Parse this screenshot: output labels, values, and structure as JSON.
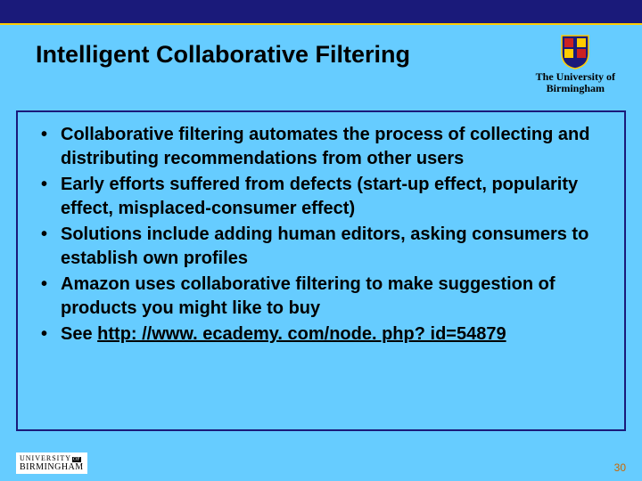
{
  "header": {
    "title": "Intelligent Collaborative Filtering",
    "university_line1": "The University of",
    "university_line2": "Birmingham"
  },
  "bullets": [
    "Collaborative filtering automates the process of collecting and distributing recommendations from other users",
    "Early efforts suffered from defects (start-up effect, popularity effect, misplaced-consumer effect)",
    "Solutions include adding human editors, asking consumers to establish own profiles",
    "Amazon uses collaborative filtering to make suggestion of products you might like to buy"
  ],
  "see_prefix": "See ",
  "see_link": "http: //www. ecademy. com/node. php? id=54879",
  "footer": {
    "logo_line1": "UNIVERSITY",
    "logo_of": "OF",
    "logo_line2": "BIRMINGHAM",
    "page_number": "30"
  }
}
